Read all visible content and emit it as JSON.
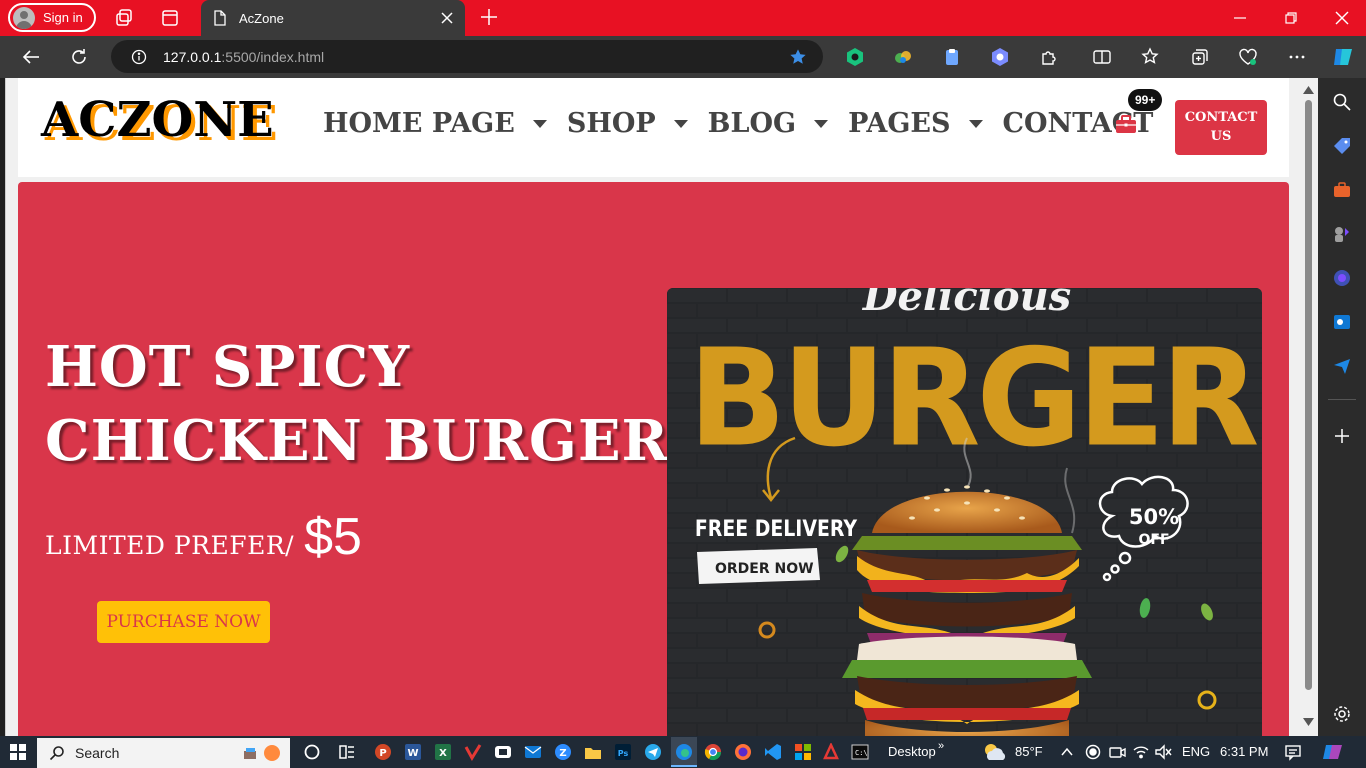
{
  "browser": {
    "signin_label": "Sign in",
    "tab_title": "AcZone",
    "url_host": "127.0.0.1",
    "url_rest": ":5500/index.html"
  },
  "site": {
    "logo": "ACZONE",
    "menu": [
      {
        "label": "HOME PAGE",
        "dropdown": true
      },
      {
        "label": "SHOP",
        "dropdown": true
      },
      {
        "label": "BLOG",
        "dropdown": true
      },
      {
        "label": "PAGES",
        "dropdown": true
      },
      {
        "label": "CONTACT",
        "dropdown": false
      }
    ],
    "cart_badge": "99+",
    "contact_button": {
      "line1": "CONTACT",
      "line2": "US"
    },
    "hero": {
      "title_line1": "HOT SPICY",
      "title_line2": "CHICKEN BURGER",
      "offer_label": "LIMITED PREFER/",
      "price": "$5",
      "cta": "PURCHASE NOW"
    },
    "promo": {
      "script_text": "Delicious",
      "headline": "BURGER",
      "free_delivery": "FREE DELIVERY",
      "order_now": "ORDER NOW",
      "discount_value": "50%",
      "discount_label": "OFF"
    }
  },
  "taskbar": {
    "search_label": "Search",
    "desktop_label": "Desktop",
    "temperature": "85°F",
    "language": "ENG",
    "time": "6:31 PM"
  },
  "colors": {
    "chrome_red": "#e81123",
    "hero_red": "#d9364a",
    "accent_yellow": "#ffc107",
    "logo_shadow": "#ff9800",
    "burger_gold": "#d49a1e"
  }
}
